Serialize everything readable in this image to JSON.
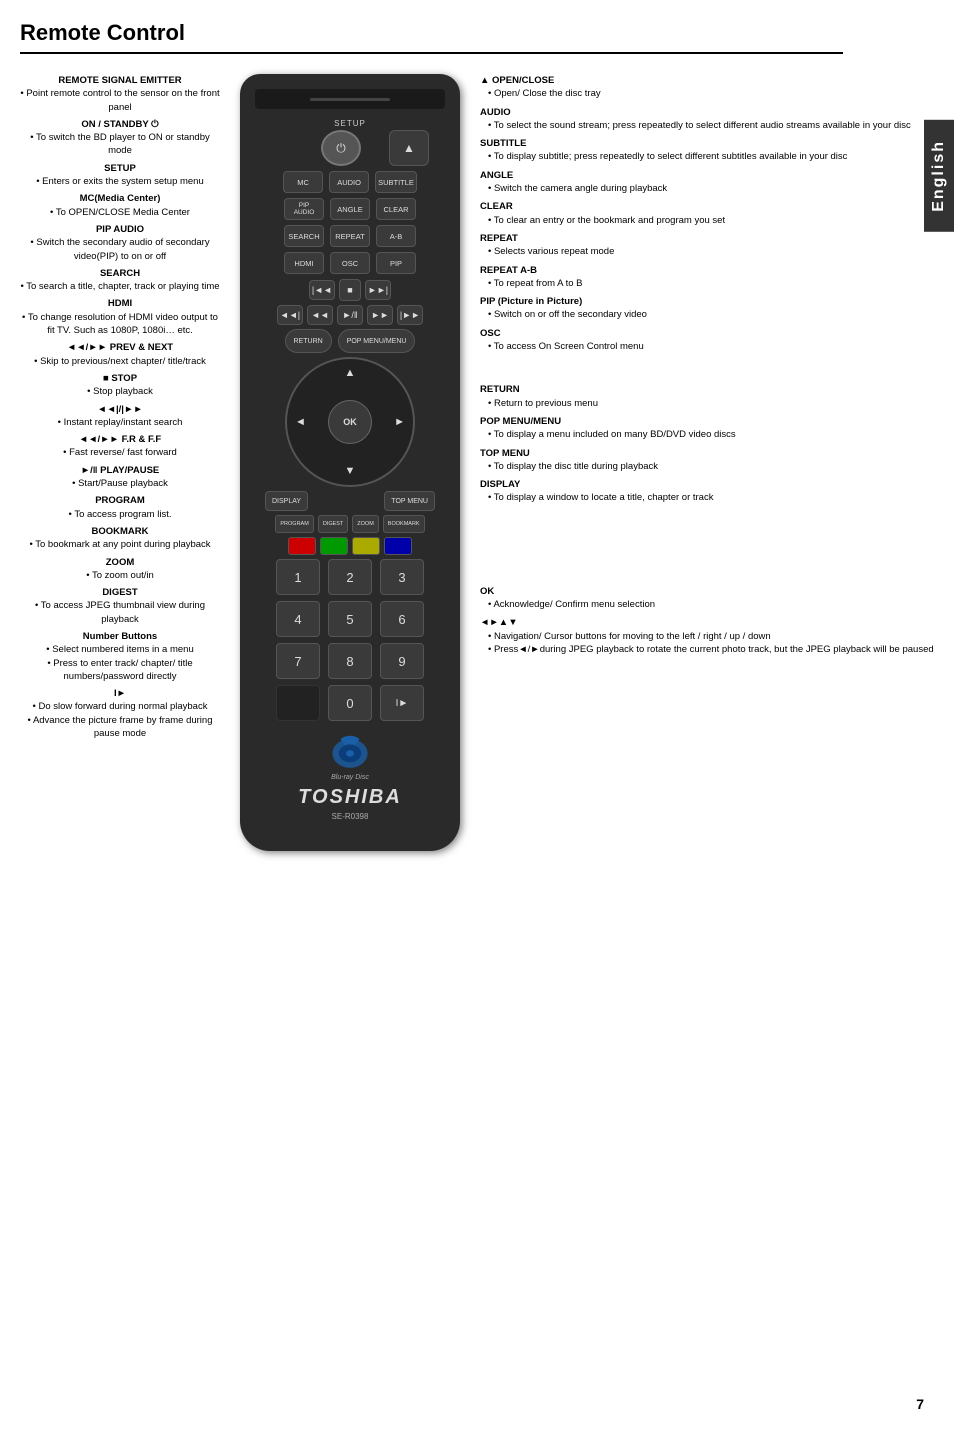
{
  "page": {
    "title": "Remote Control",
    "number": "7",
    "language_tab": "English"
  },
  "left_column": {
    "sections": [
      {
        "label": "REMOTE SIGNAL EMITTER",
        "desc": "• Point remote control to the sensor on the front panel"
      },
      {
        "label": "ON / STANDBY ⏻",
        "desc": "• To switch the BD player to ON or standby mode"
      },
      {
        "label": "SETUP",
        "desc": "• Enters or exits the system setup menu"
      },
      {
        "label": "MC(Media Center)",
        "desc": "• To OPEN/CLOSE Media Center"
      },
      {
        "label": "PIP AUDIO",
        "desc": "• Switch the secondary audio of secondary video(PIP) to on or off"
      },
      {
        "label": "SEARCH",
        "desc": "• To search a title, chapter, track or playing time"
      },
      {
        "label": "HDMI",
        "desc": "• To change resolution of HDMI video output to fit TV. Such as 1080P, 1080i… etc."
      },
      {
        "label": "◄◄/►► PREV & NEXT",
        "desc": "• Skip to previous/next chapter/ title/track"
      },
      {
        "label": "■ STOP",
        "desc": "• Stop playback"
      },
      {
        "label": "◄◄|/|►►",
        "desc": "• Instant replay/instant search"
      },
      {
        "label": "◄◄/►► F.R & F.F",
        "desc": "• Fast reverse/ fast forward"
      },
      {
        "label": "►/‖ PLAY/PAUSE",
        "desc": "• Start/Pause playback"
      },
      {
        "label": "PROGRAM",
        "desc": "• To access program list."
      },
      {
        "label": "BOOKMARK",
        "desc": "• To bookmark at any point during playback"
      },
      {
        "label": "ZOOM",
        "desc": "• To zoom out/in"
      },
      {
        "label": "DIGEST",
        "desc": "• To access JPEG thumbnail view during playback"
      },
      {
        "label": "Number Buttons",
        "desc": "• Select numbered items in a menu\n• Press to enter track/ chapter/ title numbers/password directly"
      },
      {
        "label": "I►",
        "desc": "• Do a slow forward during normal playback\n• Advance the picture frame by frame during pause mode"
      }
    ]
  },
  "remote": {
    "setup_label": "SETUP",
    "buttons": {
      "mc": "MC",
      "audio": "AUDIO",
      "subtitle": "SUBTITLE",
      "pip_audio": "PIP\nAUDIO",
      "angle": "ANGLE",
      "clear": "CLEAR",
      "search": "SEARCH",
      "repeat": "REPEAT",
      "ab": "A-B",
      "hdmi": "HDMI",
      "osc": "OSC",
      "pip": "PIP",
      "return_btn": "RETURN",
      "pop_menu": "POP MENU/MENU",
      "display": "DISPLAY",
      "top_menu": "TOP MENU",
      "ok": "OK",
      "program": "PROGRAM",
      "digest": "DIGEST",
      "zoom": "ZOOM",
      "bookmark": "BOOKMARK"
    },
    "numpad": [
      "1",
      "2",
      "3",
      "4",
      "5",
      "6",
      "7",
      "8",
      "9",
      "",
      "0",
      ""
    ],
    "brand": "TOSHIBA",
    "model": "SE-R0398"
  },
  "right_column": {
    "sections": [
      {
        "label": "▲ OPEN/CLOSE",
        "items": [
          "Open/ Close the disc tray"
        ]
      },
      {
        "label": "AUDIO",
        "items": [
          "To select the sound stream; press repeatedly to select different audio streams available in your disc"
        ]
      },
      {
        "label": "SUBTITLE",
        "items": [
          "To display subtitle; press repeatedly to select different subtitles available in your disc"
        ]
      },
      {
        "label": "ANGLE",
        "items": [
          "Switch the camera angle during playback"
        ]
      },
      {
        "label": "CLEAR",
        "items": [
          "To clear an entry or the bookmark and program you set"
        ]
      },
      {
        "label": "REPEAT",
        "items": [
          "Selects various repeat mode"
        ]
      },
      {
        "label": "REPEAT A-B",
        "items": [
          "To repeat from A to B"
        ]
      },
      {
        "label": "PIP (Picture in Picture)",
        "items": [
          "Switch on or off the secondary video"
        ]
      },
      {
        "label": "OSC",
        "items": [
          "To access On Screen Control menu"
        ]
      },
      {
        "label": "RETURN",
        "items": [
          "Return to previous menu"
        ]
      },
      {
        "label": "POP MENU/MENU",
        "items": [
          "To display a menu included on many BD/DVD video discs"
        ]
      },
      {
        "label": "TOP MENU",
        "items": [
          "To display the disc title during playback"
        ]
      },
      {
        "label": "DISPLAY",
        "items": [
          "To display a window to locate a title, chapter or track"
        ]
      },
      {
        "label": "OK",
        "items": [
          "Acknowledge/ Confirm menu selection"
        ]
      },
      {
        "label": "◄►▲▼",
        "items": [
          "Navigation/ Cursor buttons for moving to the left / right / up / down",
          "Press◄/►during JPEG playback to rotate the current photo track, but the JPEG playback will be paused"
        ]
      }
    ]
  }
}
